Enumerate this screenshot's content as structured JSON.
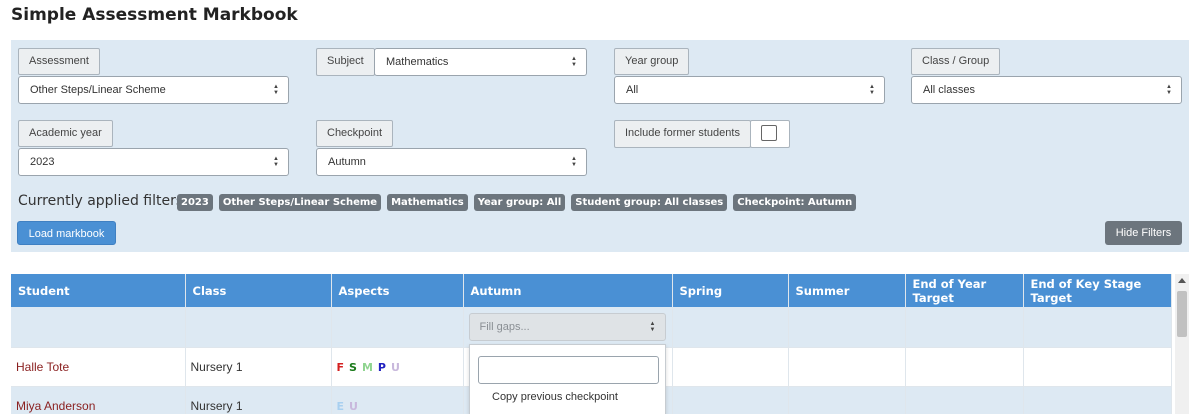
{
  "page_title": "Simple Assessment Markbook",
  "filters": {
    "assessment": {
      "label": "Assessment",
      "value": "Other Steps/Linear Scheme"
    },
    "subject": {
      "label": "Subject",
      "value": "Mathematics"
    },
    "year_group": {
      "label": "Year group",
      "value": "All"
    },
    "class_group": {
      "label": "Class / Group",
      "value": "All classes"
    },
    "academic_year": {
      "label": "Academic year",
      "value": "2023"
    },
    "checkpoint": {
      "label": "Checkpoint",
      "value": "Autumn"
    },
    "include_former": {
      "label": "Include former students",
      "checked": false
    }
  },
  "applied_filters_label": "Currently applied filters:",
  "applied_filters": [
    "2023",
    "Other Steps/Linear Scheme",
    "Mathematics",
    "Year group: All",
    "Student group: All classes",
    "Checkpoint: Autumn"
  ],
  "buttons": {
    "load": "Load markbook",
    "hide_filters": "Hide Filters"
  },
  "table": {
    "columns": [
      "Student",
      "Class",
      "Aspects",
      "Autumn",
      "Spring",
      "Summer",
      "End of Year Target",
      "End of Key Stage Target"
    ],
    "fill_gaps_placeholder": "Fill gaps...",
    "rows": [
      {
        "student": "Halle Tote",
        "class": "Nursery 1",
        "aspects": [
          {
            "letter": "F",
            "color": "#d42020"
          },
          {
            "letter": "S",
            "color": "#1a7a1a"
          },
          {
            "letter": "M",
            "color": "#8fd48f"
          },
          {
            "letter": "P",
            "color": "#2020c0"
          },
          {
            "letter": "U",
            "color": "#c8b8dc"
          }
        ]
      },
      {
        "student": "Miya Anderson",
        "class": "Nursery 1",
        "aspects": [
          {
            "letter": "E",
            "color": "#a8d0f0"
          },
          {
            "letter": "U",
            "color": "#c8b8dc"
          }
        ]
      }
    ]
  },
  "dropdown": {
    "search_value": "",
    "option": "Copy previous checkpoint"
  }
}
